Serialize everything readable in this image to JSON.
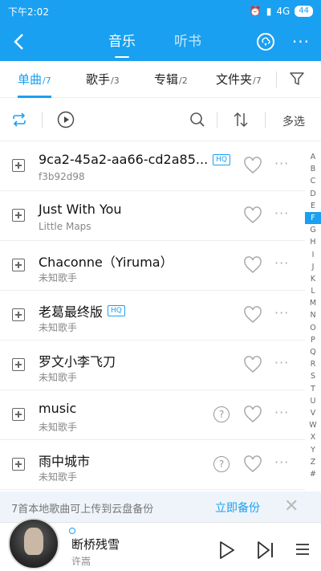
{
  "status_bar": {
    "time": "下午2:02",
    "network": "4G",
    "battery": "44"
  },
  "header": {
    "back_icon": "back-arrow-icon",
    "tabs": [
      {
        "label": "音乐",
        "active": true
      },
      {
        "label": "听书",
        "active": false
      }
    ],
    "cloud_icon": "cloud-download-icon",
    "more_icon": "more-dots-icon"
  },
  "subtabs": [
    {
      "label": "单曲",
      "count": "/7",
      "active": true
    },
    {
      "label": "歌手",
      "count": "/3",
      "active": false
    },
    {
      "label": "专辑",
      "count": "/2",
      "active": false
    },
    {
      "label": "文件夹",
      "count": "/7",
      "active": false
    }
  ],
  "toolbar": {
    "multi_select_label": "多选"
  },
  "songs": [
    {
      "title": "9ca2-45a2-aa66-cd2a85...",
      "hq": "HQ",
      "artist": "f3b92d98",
      "unknown": false
    },
    {
      "title": "Just With You",
      "hq": "",
      "artist": "Little Maps",
      "unknown": false
    },
    {
      "title": "Chaconne（Yiruma）",
      "hq": "",
      "artist": "未知歌手",
      "unknown": false
    },
    {
      "title": "老葛最终版",
      "hq": "HQ",
      "artist": "未知歌手",
      "unknown": false
    },
    {
      "title": "罗文小李飞刀",
      "hq": "",
      "artist": "未知歌手",
      "unknown": false
    },
    {
      "title": "music",
      "hq": "",
      "artist": "未知歌手",
      "unknown": true
    },
    {
      "title": "雨中城市",
      "hq": "",
      "artist": "未知歌手",
      "unknown": true
    }
  ],
  "index_letters": [
    "A",
    "B",
    "C",
    "D",
    "E",
    "F",
    "G",
    "H",
    "I",
    "J",
    "K",
    "L",
    "M",
    "N",
    "O",
    "P",
    "Q",
    "R",
    "S",
    "T",
    "U",
    "V",
    "W",
    "X",
    "Y",
    "Z",
    "#"
  ],
  "active_index_letter": "F",
  "backup_banner": {
    "text": "7首本地歌曲可上传到云盘备份",
    "action": "立即备份",
    "close_icon": "close-icon"
  },
  "now_playing": {
    "title": "断桥残雪",
    "artist": "许嵩"
  },
  "colors": {
    "accent": "#1aa0f0"
  }
}
